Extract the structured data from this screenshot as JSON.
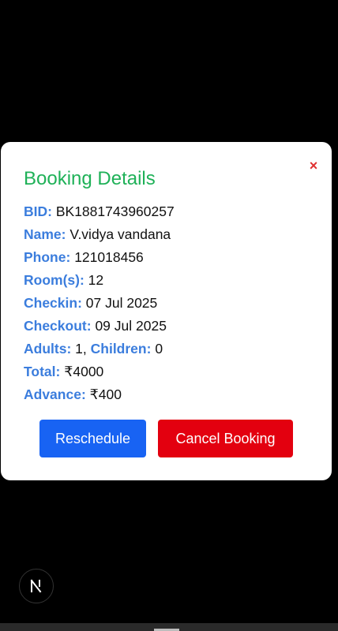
{
  "modal": {
    "title": "Booking Details",
    "close_glyph": "×",
    "fields": {
      "bid": {
        "label": "BID:",
        "value": "BK1881743960257"
      },
      "name": {
        "label": "Name:",
        "value": "V.vidya vandana"
      },
      "phone": {
        "label": "Phone:",
        "value": "121018456"
      },
      "rooms": {
        "label": "Room(s):",
        "value": "12"
      },
      "checkin": {
        "label": "Checkin:",
        "value": "07 Jul 2025"
      },
      "checkout": {
        "label": "Checkout:",
        "value": "09 Jul 2025"
      },
      "adults": {
        "label": "Adults:",
        "value": "1"
      },
      "children": {
        "label": "Children:",
        "value": "0"
      },
      "total": {
        "label": "Total:",
        "value": "₹4000"
      },
      "advance": {
        "label": "Advance:",
        "value": "₹400"
      }
    },
    "buttons": {
      "reschedule": "Reschedule",
      "cancel": "Cancel Booking"
    }
  },
  "colors": {
    "title": "#1fb158",
    "label": "#3b7ddd",
    "reschedule": "#1863f3",
    "cancel": "#e3000f",
    "close": "#e03131"
  },
  "overlay_badge": {
    "icon": "next-logo-icon"
  }
}
